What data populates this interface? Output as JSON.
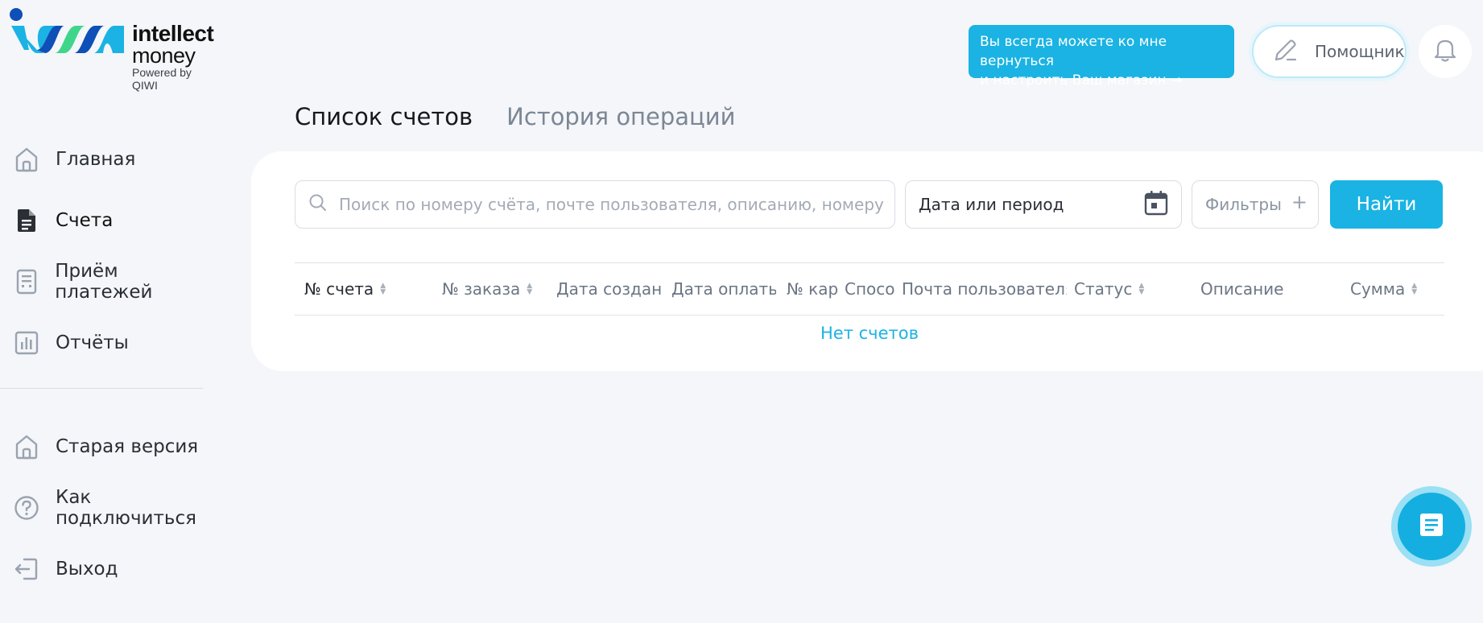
{
  "brand": {
    "name_line1": "intellect",
    "name_line2": "money",
    "powered_by": "Powered by QIWI",
    "colors": {
      "accent": "#1ab3e3",
      "logo_blue": "#0e4fb8",
      "logo_green": "#3fd68c"
    }
  },
  "sidebar": {
    "items": [
      {
        "label": "Главная",
        "icon": "home-icon"
      },
      {
        "label": "Счета",
        "icon": "document-icon",
        "active": true
      },
      {
        "label": "Приём платежей",
        "icon": "terminal-icon"
      },
      {
        "label": "Отчёты",
        "icon": "chart-icon"
      }
    ],
    "bottom_items": [
      {
        "label": "Старая версия",
        "icon": "home-icon"
      },
      {
        "label": "Как подключиться",
        "icon": "question-icon"
      },
      {
        "label": "Выход",
        "icon": "logout-icon"
      }
    ]
  },
  "header": {
    "hint_line1": "Вы всегда можете ко мне вернуться",
    "hint_line2": "и настроить Ваш магазин →",
    "helper_label": "Помощник",
    "bell_icon": "bell-icon"
  },
  "tabs": [
    {
      "label": "Список счетов",
      "active": true
    },
    {
      "label": "История операций",
      "active": false
    }
  ],
  "filters": {
    "search_placeholder": "Поиск по номеру счёта, почте пользователя, описанию, номеру карты",
    "search_value": "",
    "date_label": "Дата или период",
    "filters_label": "Фильтры",
    "plus_glyph": "+",
    "find_label": "Найти"
  },
  "table": {
    "columns": [
      {
        "label": "№ счета",
        "sortable": true
      },
      {
        "label": "№ заказа",
        "sortable": true
      },
      {
        "label": "Дата создани",
        "sortable": false
      },
      {
        "label": "Дата оплаты",
        "sortable": false
      },
      {
        "label": "№ кар",
        "sortable": false
      },
      {
        "label": "Спосо",
        "sortable": false
      },
      {
        "label": "Почта пользователя",
        "sortable": false
      },
      {
        "label": "Статус",
        "sortable": true
      },
      {
        "label": "Описание",
        "sortable": false
      },
      {
        "label": "Сумма",
        "sortable": true
      }
    ],
    "rows": [],
    "empty_text": "Нет счетов"
  },
  "chat": {
    "icon": "chat-icon"
  }
}
